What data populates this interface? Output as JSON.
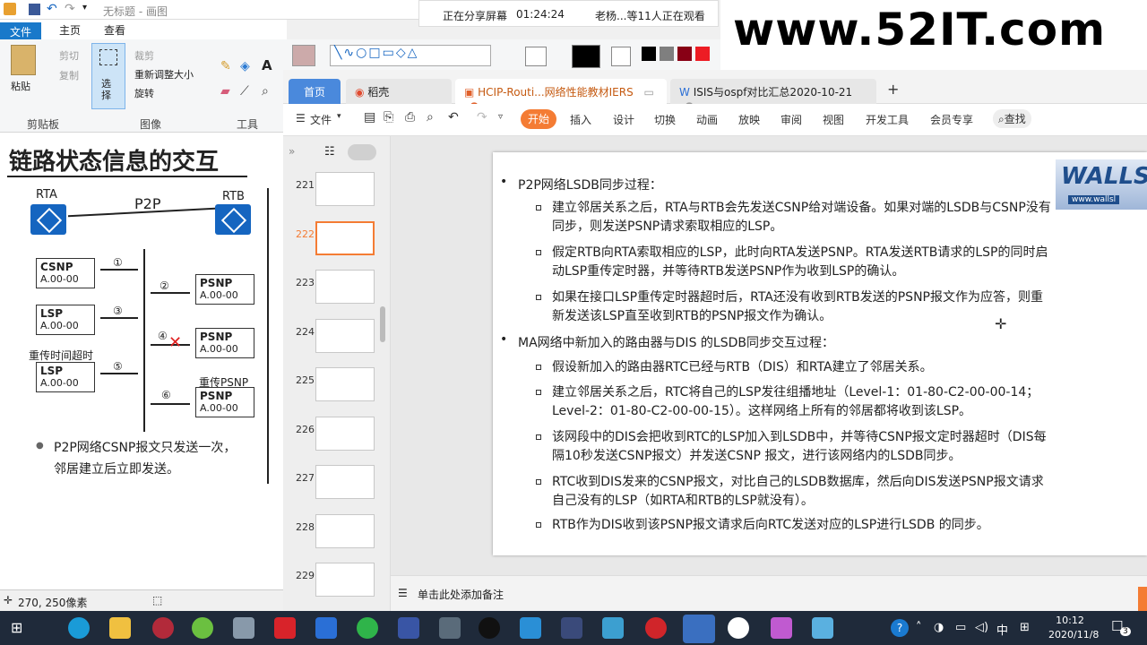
{
  "paint": {
    "title": "无标题 - 画图",
    "tabs": [
      "文件",
      "主页",
      "查看"
    ],
    "clipboard": {
      "paste": "粘贴",
      "cut": "剪切",
      "copy": "复制",
      "label": "剪贴板"
    },
    "image": {
      "select": "选\n择",
      "crop": "裁剪",
      "resize": "重新调整大小",
      "rotate": "旋转",
      "label": "图像"
    },
    "tools_label": "工具",
    "status_coords": "270, 250像素"
  },
  "share": {
    "status": "正在分享屏幕",
    "time": "01:24:24",
    "viewers": "老杨...等11人正在观看"
  },
  "watermark": "www.52IT.com",
  "left_slide": {
    "heading": "链路状态信息的交互",
    "rta": "RTA",
    "rtb": "RTB",
    "p2p": "P2P",
    "packets": [
      {
        "type": "CSNP",
        "id": "A.00-00"
      },
      {
        "type": "LSP",
        "id": "A.00-00"
      },
      {
        "type": "LSP",
        "id": "A.00-00"
      },
      {
        "type": "PSNP",
        "id": "A.00-00"
      },
      {
        "type": "PSNP",
        "id": "A.00-00"
      },
      {
        "type": "PSNP",
        "id": "A.00-00"
      }
    ],
    "steps": [
      "①",
      "②",
      "③",
      "④",
      "⑤",
      "⑥"
    ],
    "retransmit_timeout": "重传时间超时",
    "retransmit_psnp": "重传PSNP",
    "bullet": "P2P网络CSNP报文只发送一次，\n邻居建立后立即发送。"
  },
  "wps": {
    "tabs": [
      {
        "label": "首页"
      },
      {
        "label": "稻壳"
      },
      {
        "label": "HCIP-Routi...网络性能教材IERS"
      },
      {
        "label": "ISIS与ospf对比汇总2020-10-21"
      }
    ],
    "menu": [
      "文件",
      "开始",
      "插入",
      "设计",
      "切换",
      "动画",
      "放映",
      "审阅",
      "视图",
      "开发工具",
      "会员专享",
      "查找"
    ],
    "thumbs": [
      "221",
      "222",
      "223",
      "224",
      "225",
      "226",
      "227",
      "228",
      "229"
    ],
    "note_placeholder": "单击此处添加备注"
  },
  "slide": {
    "logo": "WALLS",
    "logo_url": "www.wallsl",
    "b1": "P2P网络LSDB同步过程：",
    "b1_items": [
      "建立邻居关系之后，RTA与RTB会先发送CSNP给对端设备。如果对端的LSDB与CSNP没有同步，则发送PSNP请求索取相应的LSP。",
      "假定RTB向RTA索取相应的LSP，此时向RTA发送PSNP。RTA发送RTB请求的LSP的同时启动LSP重传定时器，并等待RTB发送PSNP作为收到LSP的确认。",
      "如果在接口LSP重传定时器超时后，RTA还没有收到RTB发送的PSNP报文作为应答，则重新发送该LSP直至收到RTB的PSNP报文作为确认。"
    ],
    "b2": "MA网络中新加入的路由器与DIS 的LSDB同步交互过程：",
    "b2_items": [
      "假设新加入的路由器RTC已经与RTB（DIS）和RTA建立了邻居关系。",
      "建立邻居关系之后，RTC将自己的LSP发往组播地址（Level-1：01-80-C2-00-00-14；Level-2：01-80-C2-00-00-15）。这样网络上所有的邻居都将收到该LSP。",
      "该网段中的DIS会把收到RTC的LSP加入到LSDB中，并等待CSNP报文定时器超时（DIS每隔10秒发送CSNP报文）并发送CSNP 报文，进行该网络内的LSDB同步。",
      "RTC收到DIS发来的CSNP报文，对比自己的LSDB数据库，然后向DIS发送PSNP报文请求自己没有的LSP（如RTA和RTB的LSP就没有）。",
      "RTB作为DIS收到该PSNP报文请求后向RTC发送对应的LSP进行LSDB 的同步。"
    ]
  },
  "taskbar": {
    "time": "10:12",
    "date": "2020/11/8",
    "ime": "中",
    "notif": "3"
  }
}
